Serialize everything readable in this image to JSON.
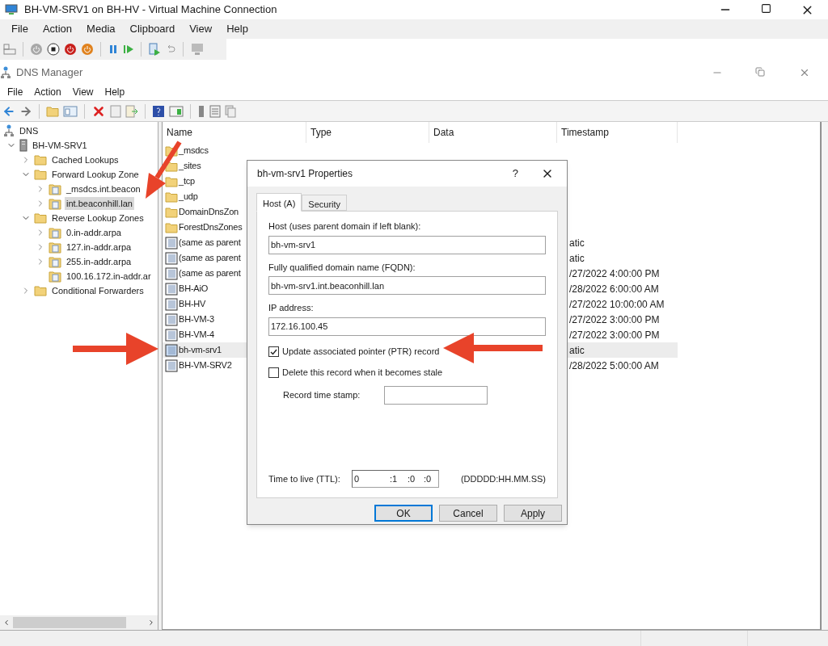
{
  "vm_window": {
    "title": "BH-VM-SRV1 on BH-HV - Virtual Machine Connection",
    "menu": [
      "File",
      "Action",
      "Media",
      "Clipboard",
      "View",
      "Help"
    ]
  },
  "dns_window": {
    "title": "DNS Manager",
    "menu": [
      "File",
      "Action",
      "View",
      "Help"
    ]
  },
  "tree": [
    {
      "label": "DNS",
      "kind": "dns",
      "selected": false,
      "children": [
        {
          "label": "BH-VM-SRV1",
          "kind": "server",
          "expanded": true,
          "selected": false,
          "children": [
            {
              "label": "Cached Lookups",
              "kind": "folder",
              "expanded": false,
              "selected": false
            },
            {
              "label": "Forward Lookup Zone",
              "kind": "folder",
              "expanded": true,
              "selected": false,
              "children": [
                {
                  "label": "_msdcs.int.beacon",
                  "kind": "zone",
                  "expanded": false,
                  "selected": false
                },
                {
                  "label": "int.beaconhill.lan",
                  "kind": "zone",
                  "expanded": false,
                  "selected": true
                }
              ]
            },
            {
              "label": "Reverse Lookup Zones",
              "kind": "folder",
              "expanded": true,
              "selected": false,
              "children": [
                {
                  "label": "0.in-addr.arpa",
                  "kind": "zone",
                  "expanded": false,
                  "selected": false
                },
                {
                  "label": "127.in-addr.arpa",
                  "kind": "zone",
                  "expanded": false,
                  "selected": false
                },
                {
                  "label": "255.in-addr.arpa",
                  "kind": "zone",
                  "expanded": false,
                  "selected": false
                },
                {
                  "label": "100.16.172.in-addr.ar",
                  "kind": "zone",
                  "selected": false
                }
              ]
            },
            {
              "label": "Conditional Forwarders",
              "kind": "folder",
              "expanded": false,
              "selected": false
            }
          ]
        }
      ]
    }
  ],
  "list": {
    "columns": [
      "Name",
      "Type",
      "Data",
      "Timestamp"
    ],
    "rows": [
      {
        "name": "_msdcs",
        "kind": "folder",
        "selected": false
      },
      {
        "name": "_sites",
        "kind": "folder",
        "selected": false
      },
      {
        "name": "_tcp",
        "kind": "folder",
        "selected": false
      },
      {
        "name": "_udp",
        "kind": "folder",
        "selected": false
      },
      {
        "name": "DomainDnsZon",
        "kind": "folder",
        "selected": false
      },
      {
        "name": "ForestDnsZones",
        "kind": "folder",
        "selected": false
      },
      {
        "name": "(same as parent",
        "kind": "record",
        "selected": false,
        "timestamp": "atic"
      },
      {
        "name": "(same as parent",
        "kind": "record",
        "selected": false,
        "timestamp": "atic"
      },
      {
        "name": "(same as parent",
        "kind": "record",
        "selected": false,
        "timestamp": "/27/2022 4:00:00 PM"
      },
      {
        "name": "BH-AiO",
        "kind": "record",
        "selected": false,
        "timestamp": "/28/2022 6:00:00 AM"
      },
      {
        "name": "BH-HV",
        "kind": "record",
        "selected": false,
        "timestamp": "/27/2022 10:00:00 AM"
      },
      {
        "name": "BH-VM-3",
        "kind": "record",
        "selected": false,
        "timestamp": "/27/2022 3:00:00 PM"
      },
      {
        "name": "BH-VM-4",
        "kind": "record",
        "selected": false,
        "timestamp": "/27/2022 3:00:00 PM"
      },
      {
        "name": "bh-vm-srv1",
        "kind": "record",
        "selected": true,
        "timestamp": "atic"
      },
      {
        "name": "BH-VM-SRV2",
        "kind": "record",
        "selected": false,
        "timestamp": "/28/2022 5:00:00 AM"
      }
    ]
  },
  "dialog": {
    "title": "bh-vm-srv1 Properties",
    "help": "?",
    "tabs": [
      {
        "label": "Host (A)",
        "selected": true
      },
      {
        "label": "Security",
        "selected": false
      }
    ],
    "fields": [
      {
        "label": "Host (uses parent domain if left blank):",
        "value": "bh-vm-srv1"
      },
      {
        "label": "Fully qualified domain name (FQDN):",
        "value": "bh-vm-srv1.int.beaconhill.lan"
      },
      {
        "label": "IP address:",
        "value": "172.16.100.45"
      }
    ],
    "checkboxes": [
      {
        "label": "Update associated pointer (PTR) record",
        "checked": true
      },
      {
        "label": "Delete this record when it becomes stale",
        "checked": false
      }
    ],
    "timestamp_label": "Record time stamp:",
    "ttl": {
      "label": "Time to live (TTL):",
      "days": "0",
      "hours": ":1",
      "minutes": ":0",
      "seconds": ":0",
      "format": "(DDDDD:HH.MM.SS)"
    },
    "buttons": [
      {
        "label": "OK",
        "default": true
      },
      {
        "label": "Cancel",
        "default": false
      },
      {
        "label": "Apply",
        "default": false
      }
    ]
  }
}
